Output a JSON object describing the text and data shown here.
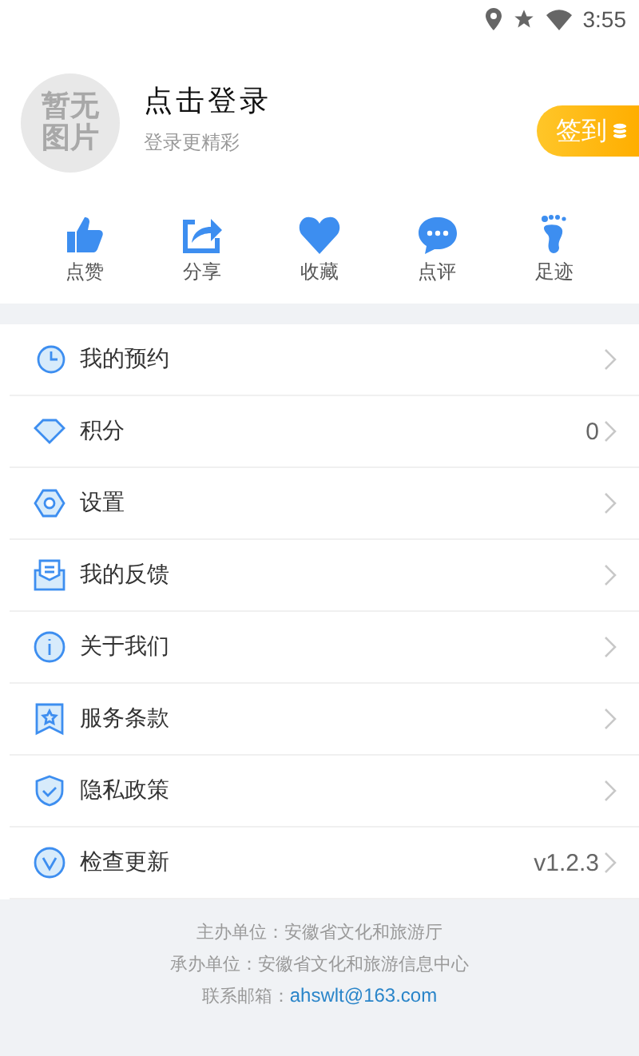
{
  "status_bar": {
    "time": "3:55"
  },
  "profile": {
    "avatar_lines": [
      "暂无",
      "图片"
    ],
    "title": "点击登录",
    "subtitle": "登录更精彩",
    "checkin": "签到"
  },
  "actions": [
    {
      "kind": "like",
      "label": "点赞"
    },
    {
      "kind": "share",
      "label": "分享"
    },
    {
      "kind": "favorite",
      "label": "收藏"
    },
    {
      "kind": "comment",
      "label": "点评"
    },
    {
      "kind": "footprint",
      "label": "足迹"
    }
  ],
  "menu": [
    {
      "kind": "booking",
      "label": "我的预约"
    },
    {
      "kind": "points",
      "label": "积分",
      "value": "0"
    },
    {
      "kind": "settings",
      "label": "设置"
    },
    {
      "kind": "feedback",
      "label": "我的反馈"
    },
    {
      "kind": "about",
      "label": "关于我们"
    },
    {
      "kind": "terms",
      "label": "服务条款"
    },
    {
      "kind": "privacy",
      "label": "隐私政策"
    },
    {
      "kind": "update",
      "label": "检查更新",
      "value": "v1.2.3"
    }
  ],
  "footer": {
    "lines": [
      "主办单位：安徽省文化和旅游厅",
      "承办单位：安徽省文化和旅游信息中心"
    ],
    "contact_label": "联系邮箱：",
    "email": "ahswlt@163.com"
  }
}
